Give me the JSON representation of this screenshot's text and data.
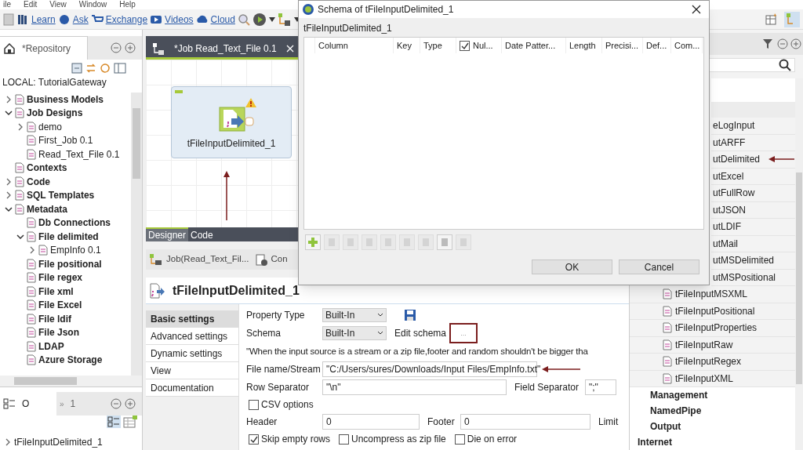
{
  "menu_bar": [
    "ile",
    "Edit",
    "View",
    "Window",
    "Help"
  ],
  "toolbar": {
    "links": [
      {
        "label": "Learn"
      },
      {
        "label": "Ask"
      },
      {
        "label": "Exchange"
      },
      {
        "label": "Videos"
      },
      {
        "label": "Cloud"
      }
    ]
  },
  "repository": {
    "tab": "*Repository",
    "root": "LOCAL: TutorialGateway",
    "tree": [
      {
        "label": "Business Models",
        "bold": true,
        "expanded": false
      },
      {
        "label": "Job Designs",
        "bold": true,
        "expanded": true,
        "children": [
          {
            "label": "demo",
            "bold": false,
            "expanded": false
          },
          {
            "label": "First_Job 0.1",
            "bold": false
          },
          {
            "label": "Read_Text_File 0.1",
            "bold": false
          }
        ]
      },
      {
        "label": "Contexts",
        "bold": true
      },
      {
        "label": "Code",
        "bold": true,
        "expanded": false
      },
      {
        "label": "SQL Templates",
        "bold": true,
        "expanded": false
      },
      {
        "label": "Metadata",
        "bold": true,
        "expanded": true,
        "children": [
          {
            "label": "Db Connections",
            "bold": true
          },
          {
            "label": "File delimited",
            "bold": true,
            "expanded": true,
            "children": [
              {
                "label": "EmpInfo 0.1",
                "bold": false,
                "expanded": false
              }
            ]
          },
          {
            "label": "File positional",
            "bold": true
          },
          {
            "label": "File regex",
            "bold": true
          },
          {
            "label": "File xml",
            "bold": true
          },
          {
            "label": "File Excel",
            "bold": true
          },
          {
            "label": "File ldif",
            "bold": true
          },
          {
            "label": "File Json",
            "bold": true
          },
          {
            "label": "LDAP",
            "bold": true
          },
          {
            "label": "Azure Storage",
            "bold": true
          }
        ]
      }
    ]
  },
  "outline": {
    "tabs": [
      {
        "label": "O",
        "selected": true
      },
      {
        "label": "1",
        "marker": "»",
        "selected": false
      }
    ],
    "tree": [
      {
        "label": "tFileInputDelimited_1",
        "expanded": false
      }
    ]
  },
  "editor": {
    "tab": "*Job Read_Text_File 0.1",
    "node": "tFileInputDelimited_1",
    "tabs": [
      {
        "label": "Designer",
        "selected": true
      },
      {
        "label": "Code",
        "selected": false
      }
    ]
  },
  "component_view": {
    "tabs": [
      {
        "label": "Job(Read_Text_Fil..."
      },
      {
        "label": "Con"
      }
    ],
    "title": "tFileInputDelimited_1",
    "nav": [
      {
        "label": "Basic settings",
        "selected": true
      },
      {
        "label": "Advanced settings",
        "selected": false
      },
      {
        "label": "Dynamic settings",
        "selected": false
      },
      {
        "label": "View",
        "selected": false
      },
      {
        "label": "Documentation",
        "selected": false
      }
    ],
    "property_type": {
      "label": "Property Type",
      "value": "Built-In"
    },
    "schema": {
      "label": "Schema",
      "value": "Built-In",
      "edit_label": "Edit schema",
      "button": "..."
    },
    "note": "\"When the input source is a stream or a zip file,footer and random shouldn't be bigger tha",
    "file_name": {
      "label": "File name/Stream",
      "value": "\"C:/Users/sures/Downloads/Input Files/EmpInfo.txt\""
    },
    "row_separator": {
      "label": "Row Separator",
      "value": "\"\\n\""
    },
    "field_separator": {
      "label": "Field Separator",
      "value": "\";\""
    },
    "csv_options": {
      "label": "CSV options",
      "checked": false
    },
    "header": {
      "label": "Header",
      "value": "0"
    },
    "footer": {
      "label": "Footer",
      "value": "0"
    },
    "limit": {
      "label": "Limit"
    },
    "options": [
      {
        "label": "Skip empty rows",
        "checked": true
      },
      {
        "label": "Uncompress as zip file",
        "checked": false
      },
      {
        "label": "Die on error",
        "checked": false
      }
    ]
  },
  "palette": {
    "items": [
      {
        "label": "eLogInput",
        "clipped": true
      },
      {
        "label": "utARFF",
        "clipped": true
      },
      {
        "label": "utDelimited",
        "clipped": true
      },
      {
        "label": "utExcel",
        "clipped": true
      },
      {
        "label": "utFullRow",
        "clipped": true
      },
      {
        "label": "utJSON",
        "clipped": true
      },
      {
        "label": "utLDIF",
        "clipped": true
      },
      {
        "label": "utMail",
        "clipped": true
      },
      {
        "label": "utMSDelimited",
        "clipped": true
      },
      {
        "label": "utMSPositional",
        "clipped": true
      },
      {
        "label": "tFileInputMSXML",
        "clipped": false
      },
      {
        "label": "tFileInputPositional",
        "clipped": false
      },
      {
        "label": "tFileInputProperties",
        "clipped": false
      },
      {
        "label": "tFileInputRaw",
        "clipped": false
      },
      {
        "label": "tFileInputRegex",
        "clipped": false
      },
      {
        "label": "tFileInputXML",
        "clipped": false
      }
    ],
    "categories": [
      "Management",
      "NamedPipe",
      "Output",
      "Internet"
    ]
  },
  "dialog": {
    "title": "Schema of tFileInputDelimited_1",
    "subtitle": "tFileInputDelimited_1",
    "columns": [
      {
        "label": "Column",
        "kind": "text"
      },
      {
        "label": "Key",
        "kind": "text"
      },
      {
        "label": "Type",
        "kind": "text"
      },
      {
        "label": "Nul...",
        "kind": "checkbox",
        "checked": true
      },
      {
        "label": "Date Patter...",
        "kind": "text"
      },
      {
        "label": "Length",
        "kind": "text"
      },
      {
        "label": "Precisi...",
        "kind": "text"
      },
      {
        "label": "Def...",
        "kind": "text"
      },
      {
        "label": "Com...",
        "kind": "text"
      }
    ],
    "tools": [
      {
        "disabled": false
      },
      {
        "disabled": true
      },
      {
        "disabled": true
      },
      {
        "disabled": true
      },
      {
        "disabled": true
      },
      {
        "disabled": true
      },
      {
        "disabled": true
      },
      {
        "disabled": false
      },
      {
        "disabled": true
      }
    ],
    "buttons": [
      "OK",
      "Cancel"
    ]
  }
}
